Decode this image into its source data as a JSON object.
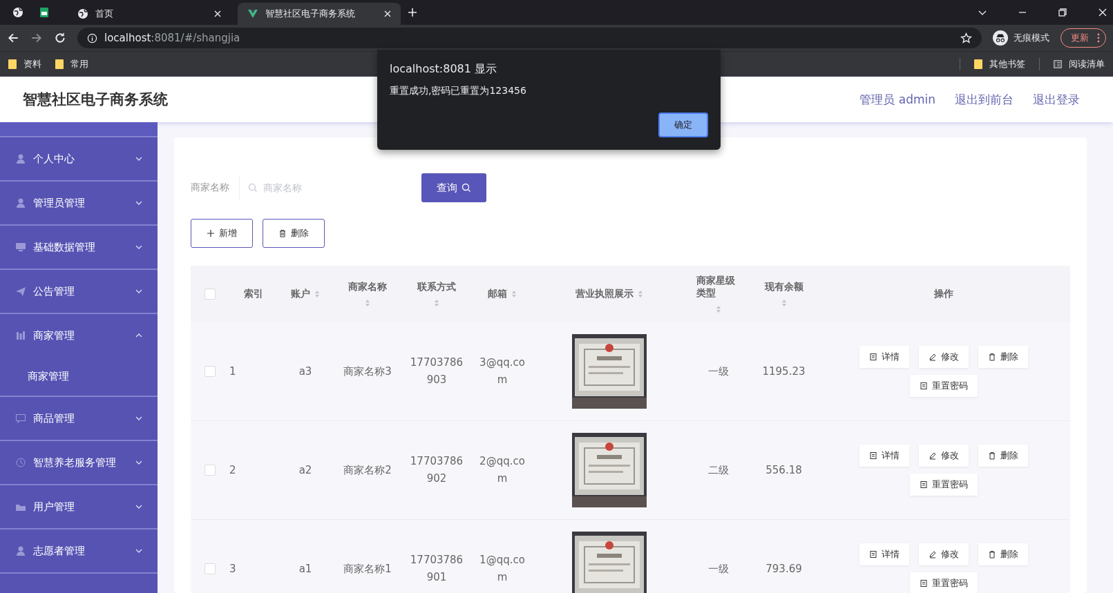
{
  "browser": {
    "tabs": [
      {
        "title": "首页",
        "selected": false,
        "kind": "globe"
      },
      {
        "title": "智慧社区电子商务系统",
        "selected": true,
        "kind": "vue"
      }
    ],
    "url_host": "localhost",
    "url_path": ":8081/#/shangjia",
    "incognito": "无痕模式",
    "update": "更新",
    "bookmarks": [
      "资料",
      "常用"
    ],
    "other_bookmarks": "其他书签",
    "reading_list": "阅读清单"
  },
  "app": {
    "title": "智慧社区电子商务系统",
    "header_links": [
      "管理员 admin",
      "退出到前台",
      "退出登录"
    ]
  },
  "sidebar": {
    "items": [
      {
        "label": "个人中心",
        "expanded": false
      },
      {
        "label": "管理员管理",
        "expanded": false
      },
      {
        "label": "基础数据管理",
        "expanded": false
      },
      {
        "label": "公告管理",
        "expanded": false
      },
      {
        "label": "商家管理",
        "expanded": true,
        "children": [
          {
            "label": "商家管理"
          }
        ]
      },
      {
        "label": "商品管理",
        "expanded": false
      },
      {
        "label": "智慧养老服务管理",
        "expanded": false
      },
      {
        "label": "用户管理",
        "expanded": false
      },
      {
        "label": "志愿者管理",
        "expanded": false
      }
    ]
  },
  "search": {
    "label": "商家名称",
    "placeholder": "商家名称",
    "button": "查询"
  },
  "actions": [
    {
      "kind": "add",
      "label": "新增"
    },
    {
      "kind": "delete",
      "label": "删除"
    }
  ],
  "table": {
    "all_checked": false,
    "columns": [
      {
        "label": "索引",
        "sortable": false
      },
      {
        "label": "账户",
        "sortable": true
      },
      {
        "label": "商家名称",
        "sortable": true
      },
      {
        "label": "联系方式",
        "sortable": true
      },
      {
        "label": "邮箱",
        "sortable": true
      },
      {
        "label": "营业执照展示",
        "sortable": true
      },
      {
        "label": "商家星级类型",
        "sortable": true
      },
      {
        "label": "现有余额",
        "sortable": true
      },
      {
        "label": "操作",
        "sortable": false
      }
    ],
    "rows": [
      {
        "checked": false,
        "index": "1",
        "account": "a3",
        "name": "商家名称3",
        "phone": "17703786903",
        "email": "3@qq.com",
        "level": "一级",
        "balance": "1195.23",
        "buttons": [
          {
            "kind": "detail",
            "label": "详情"
          },
          {
            "kind": "edit",
            "label": "修改"
          },
          {
            "kind": "delete",
            "label": "删除"
          },
          {
            "kind": "reset",
            "label": "重置密码"
          }
        ]
      },
      {
        "checked": false,
        "index": "2",
        "account": "a2",
        "name": "商家名称2",
        "phone": "17703786902",
        "email": "2@qq.com",
        "level": "二级",
        "balance": "556.18",
        "buttons": [
          {
            "kind": "detail",
            "label": "详情"
          },
          {
            "kind": "edit",
            "label": "修改"
          },
          {
            "kind": "delete",
            "label": "删除"
          },
          {
            "kind": "reset",
            "label": "重置密码"
          }
        ]
      },
      {
        "checked": false,
        "index": "3",
        "account": "a1",
        "name": "商家名称1",
        "phone": "17703786901",
        "email": "1@qq.com",
        "level": "一级",
        "balance": "793.69",
        "buttons": [
          {
            "kind": "detail",
            "label": "详情"
          },
          {
            "kind": "edit",
            "label": "修改"
          },
          {
            "kind": "delete",
            "label": "删除"
          },
          {
            "kind": "reset",
            "label": "重置密码"
          }
        ]
      }
    ]
  },
  "dialog": {
    "title": "localhost:8081 显示",
    "message": "重置成功,密码已重置为123456",
    "button": "确定"
  }
}
